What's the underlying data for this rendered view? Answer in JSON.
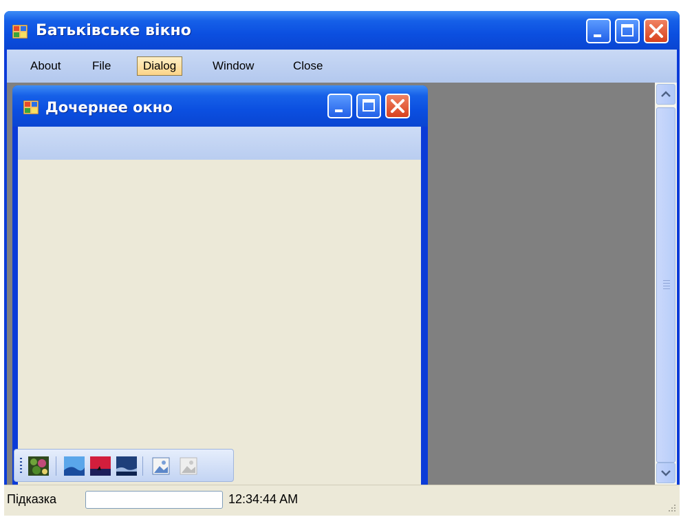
{
  "parent_window": {
    "title": "Батьківське вікно",
    "icon": "app-window-icon",
    "controls": [
      "minimize-icon",
      "maximize-icon",
      "close-icon"
    ]
  },
  "menu": {
    "items": [
      {
        "label": "About"
      },
      {
        "label": "File"
      },
      {
        "label": "Dialog",
        "active": true
      },
      {
        "label": "Window"
      },
      {
        "label": "Close"
      }
    ]
  },
  "child_window": {
    "title": "Дочернее окно",
    "icon": "app-window-icon",
    "controls": [
      "minimize-icon",
      "maximize-icon",
      "close-icon"
    ]
  },
  "toolbar": {
    "buttons": [
      {
        "icon": "garden-image-icon",
        "enabled": true
      },
      {
        "icon": "blue-hills-image-icon",
        "enabled": true
      },
      {
        "icon": "sunset-image-icon",
        "enabled": true
      },
      {
        "icon": "winter-image-icon",
        "enabled": true
      },
      {
        "icon": "picture-icon",
        "enabled": true
      },
      {
        "icon": "picture-disabled-icon",
        "enabled": false
      }
    ]
  },
  "status_bar": {
    "label": "Підказка",
    "field_value": "",
    "time": "12:34:44 AM"
  },
  "colors": {
    "title_bar": "#0b4fe0",
    "menu_bar": "#b3c8ee",
    "mdi_background": "#808080",
    "client_background": "#ece9d8",
    "close_button": "#d8421e",
    "menu_active": "#fcd489"
  }
}
